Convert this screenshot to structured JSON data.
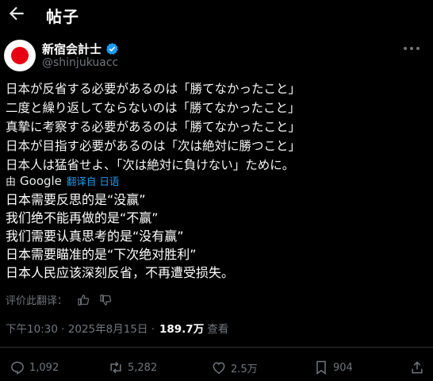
{
  "header": {
    "title": "帖子",
    "back_icon": "arrow-left-icon"
  },
  "author": {
    "name": "新宿会計士",
    "handle": "@shinjukuacc",
    "verified_color": "#1d9bf0",
    "avatar_colors": {
      "background": "#ffffff",
      "circle": "#e60012"
    }
  },
  "post": {
    "lines": [
      "日本が反省する必要があるのは「勝てなかったこと」",
      "二度と繰り返してならないのは「勝てなかったこと」",
      "真摯に考察する必要があるのは「勝てなかったこと」",
      "日本が目指す必要があるのは「次は絶対に勝つこと」",
      "日本人は猛省せよ、「次は絶対に負けない」ために。"
    ]
  },
  "translation": {
    "by_prefix": "由",
    "by_brand": "Google",
    "from_label": "翻译自 日语",
    "lines": [
      "日本需要反思的是“没赢”",
      "我们绝不能再做的是“不赢”",
      "我们需要认真思考的是“没有赢”",
      "日本需要瞄准的是“下次绝对胜利”",
      "日本人民应该深刻反省，不再遭受损失。"
    ],
    "rate_label": "评价此翻译："
  },
  "meta": {
    "time_date": "下午10:30 · 2025年8月15日 ·",
    "views": "189.7万",
    "views_label": "查看"
  },
  "actions": {
    "replies": "1,092",
    "reposts": "5,282",
    "likes": "2.5万",
    "bookmarks": "904"
  },
  "colors": {
    "background": "#000000",
    "text": "#e7e9ea",
    "muted": "#71767b",
    "link": "#1d9bf0"
  }
}
